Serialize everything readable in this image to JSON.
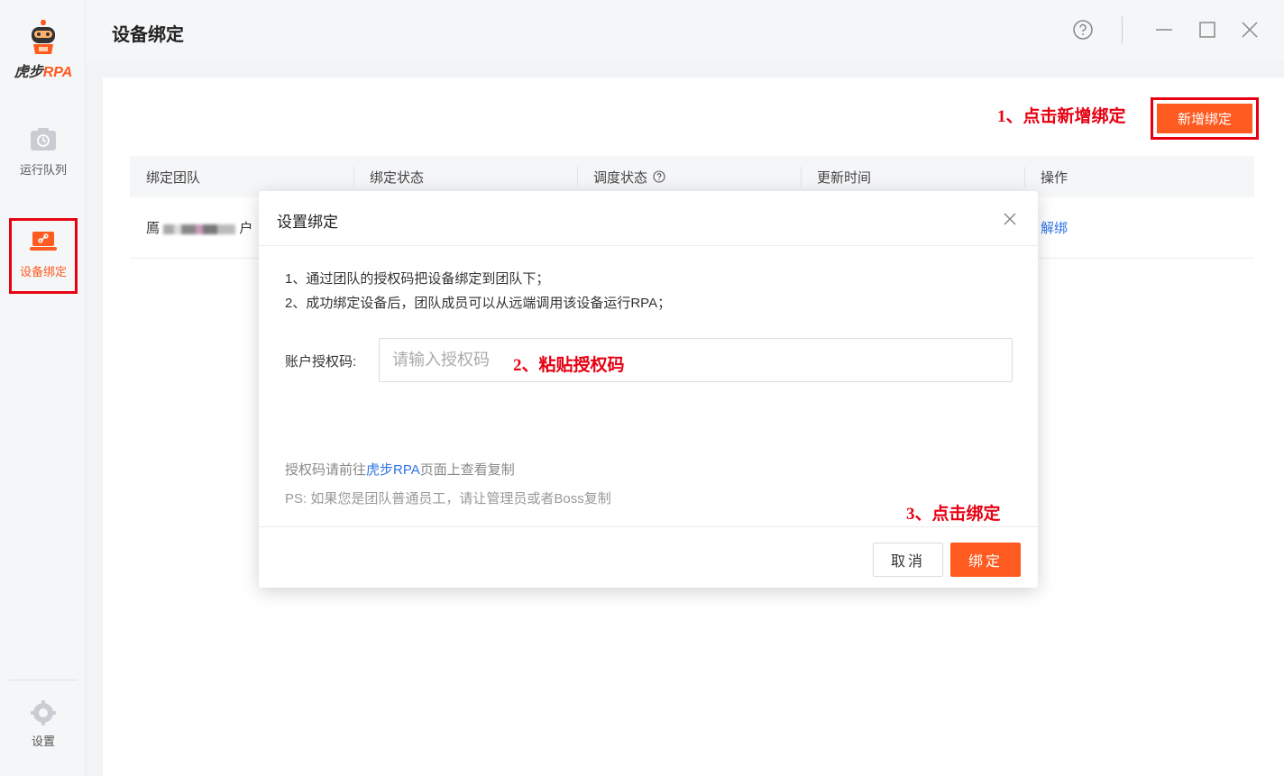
{
  "app": {
    "logo_text_a": "虎步",
    "logo_text_b": "RPA",
    "brand_color": "#ff5a1f",
    "annotation_color": "#e60012"
  },
  "sidebar": {
    "items": [
      {
        "label": "运行队列",
        "icon": "clock-icon"
      },
      {
        "label": "设备绑定",
        "icon": "laptop-link-icon",
        "active": true
      },
      {
        "label": "设置",
        "icon": "gear-icon"
      }
    ]
  },
  "header": {
    "title": "设备绑定",
    "help_icon": "help-circle-icon",
    "window_controls": [
      "minimize-icon",
      "maximize-icon",
      "close-icon"
    ]
  },
  "toolbar": {
    "annotation": "1、点击新增绑定",
    "add_label": "新增绑定"
  },
  "table": {
    "columns": [
      "绑定团队",
      "绑定状态",
      "调度状态",
      "更新时间",
      "操作"
    ],
    "rows": [
      {
        "team_prefix": "鳫",
        "team_suffix": "户",
        "action": "解绑"
      }
    ]
  },
  "modal": {
    "title": "设置绑定",
    "steps": [
      "1、通过团队的授权码把设备绑定到团队下；",
      "2、成功绑定设备后，团队成员可以从远端调用该设备运行RPA；"
    ],
    "field_label": "账户授权码:",
    "field_placeholder": "请输入授权码",
    "field_value": "",
    "annotation_paste": "2、粘贴授权码",
    "note1_prefix": "授权码请前往",
    "note1_link": "虎步RPA",
    "note1_suffix": "页面上查看复制",
    "note2": "PS: 如果您是团队普通员工，请让管理员或者Boss复制",
    "annotation_bind": "3、点击绑定",
    "cancel_label": "取消",
    "confirm_label": "绑定"
  }
}
